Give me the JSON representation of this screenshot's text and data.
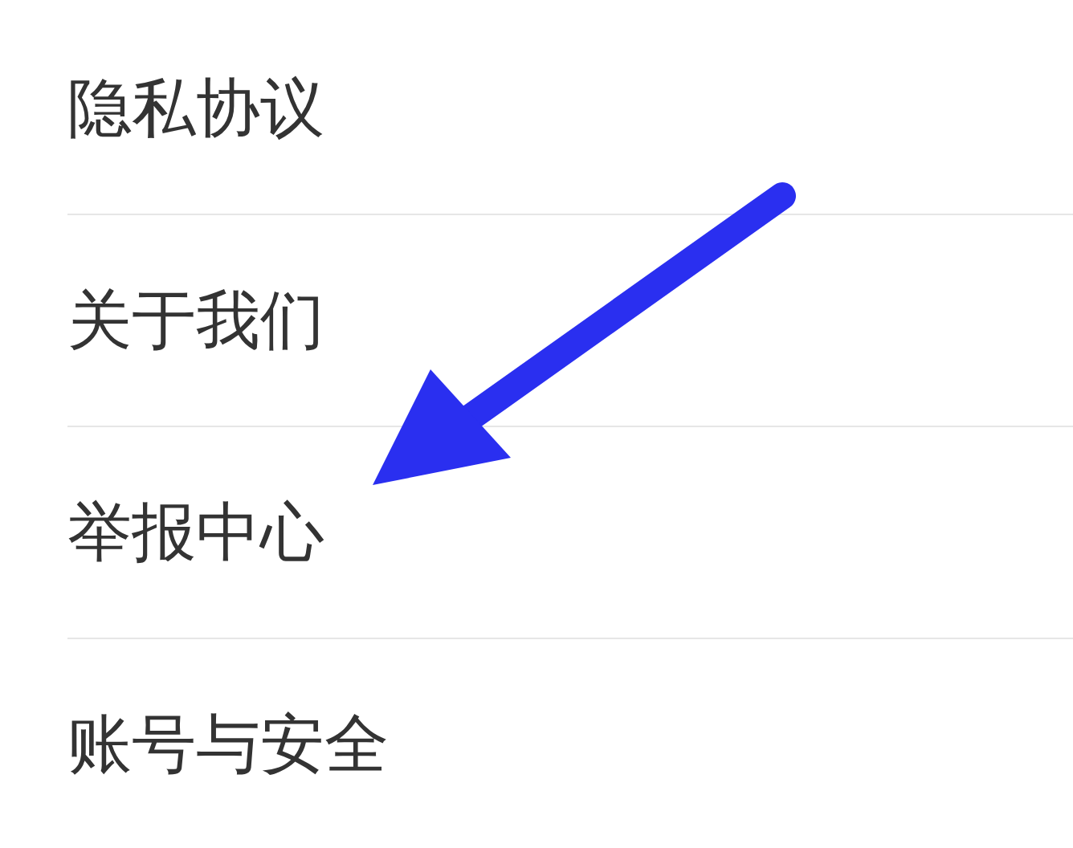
{
  "menu_items": [
    {
      "label": "隐私协议"
    },
    {
      "label": "关于我们"
    },
    {
      "label": "举报中心"
    },
    {
      "label": "账号与安全"
    }
  ]
}
